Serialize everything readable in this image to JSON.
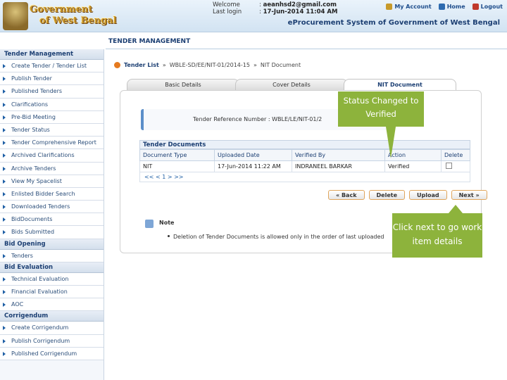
{
  "header": {
    "logo_line1": "Government",
    "logo_line2": "of West Bengal",
    "welcome_label": "Welcome",
    "welcome_value": "aeanhsd2@gmail.com",
    "lastlogin_label": "Last login",
    "lastlogin_value": "17-Jun-2014 11:04 AM",
    "links": {
      "account": "My Account",
      "home": "Home",
      "logout": "Logout"
    },
    "system_title": "eProcurement System of Government of West Bengal"
  },
  "page_title": "TENDER MANAGEMENT",
  "sidebar": {
    "sections": [
      {
        "title": "Tender Management",
        "items": [
          "Create Tender / Tender List",
          "Publish Tender",
          "Published Tenders",
          "Clarifications",
          "Pre-Bid Meeting",
          "Tender Status",
          "Tender Comprehensive Report",
          "Archived Clarifications",
          "Archive Tenders",
          "View My Spacelist",
          "Enlisted Bidder Search",
          "Downloaded Tenders",
          "BidDocuments",
          "Bids Submitted"
        ]
      },
      {
        "title": "Bid Opening",
        "items": [
          "Tenders"
        ]
      },
      {
        "title": "Bid Evaluation",
        "items": [
          "Technical Evaluation",
          "Financial Evaluation",
          "AOC"
        ]
      },
      {
        "title": "Corrigendum",
        "items": [
          "Create Corrigendum",
          "Publish Corrigendum",
          "Published Corrigendum"
        ]
      }
    ]
  },
  "breadcrumb": {
    "link": "Tender List",
    "sep1": "»",
    "part2": "WBLE-SD/EE/NIT-01/2014-15",
    "sep2": "»",
    "part3": "NIT Document"
  },
  "tabs": [
    "Basic Details",
    "Cover Details",
    "NIT Document"
  ],
  "reference": {
    "label": "Tender Reference Number :",
    "value": "WBLE/LE/NIT-01/2"
  },
  "documents": {
    "title": "Tender Documents",
    "columns": [
      "Document Type",
      "Uploaded Date",
      "Verified By",
      "Action",
      "Delete"
    ],
    "rows": [
      {
        "type": "NIT",
        "date": "17-Jun-2014 11:22 AM",
        "verified_by": "INDRANEEL BARKAR",
        "action": "Verified"
      }
    ],
    "pager": "<< < 1 > >>"
  },
  "buttons": {
    "back": "« Back",
    "delete": "Delete",
    "upload": "Upload",
    "next": "Next »"
  },
  "note": {
    "title": "Note",
    "text": "Deletion of Tender Documents is allowed only in the order of last uploaded"
  },
  "callouts": {
    "status": "Status Changed to Verified",
    "next": "Click next to go work item details"
  }
}
